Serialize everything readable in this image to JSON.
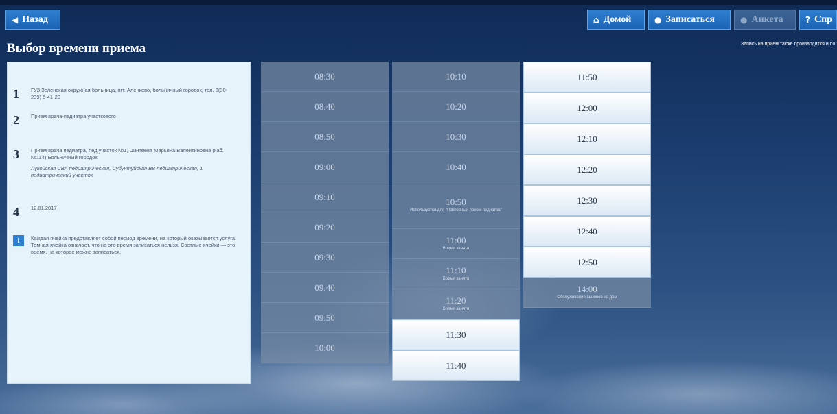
{
  "header": {
    "back_label": "Назад",
    "home_label": "Домой",
    "signup_label": "Записаться",
    "survey_label": "Анкета",
    "help_label": "Спр"
  },
  "page_title": "Выбор времени приема",
  "note_text": "Запись на прием также производится и по телефону",
  "steps": [
    {
      "num": "1",
      "text": "ГУЗ Зеленская окружная больница, пгт. Аленково, больничный городок, тел. 8(30-239) 5-41-20"
    },
    {
      "num": "2",
      "text": "Прием врача-педиатра участкового"
    },
    {
      "num": "3",
      "text": "Прием врача педиатра, пед.участок №1, Цинтеева Марьяна Валентиновна (каб.№114) Больничный городок",
      "sub": "Лукойская СВА педиатрическая, Субунтуйская ВВ педиатрическая, 1 педиатрический участок"
    },
    {
      "num": "4",
      "text": "12.01.2017"
    }
  ],
  "info_text": "Каждая ячейка представляет собой период времени, на который оказывается услуга. Темная ячейка означает, что на это время записаться нельзя. Светлые ячейки — это время, на которое можно записаться.",
  "columns": [
    [
      {
        "time": "08:30",
        "state": "busy"
      },
      {
        "time": "08:40",
        "state": "busy"
      },
      {
        "time": "08:50",
        "state": "busy"
      },
      {
        "time": "09:00",
        "state": "busy"
      },
      {
        "time": "09:10",
        "state": "busy"
      },
      {
        "time": "09:20",
        "state": "busy"
      },
      {
        "time": "09:30",
        "state": "busy"
      },
      {
        "time": "09:40",
        "state": "busy"
      },
      {
        "time": "09:50",
        "state": "busy"
      },
      {
        "time": "10:00",
        "state": "busy"
      }
    ],
    [
      {
        "time": "10:10",
        "state": "busy"
      },
      {
        "time": "10:20",
        "state": "busy"
      },
      {
        "time": "10:30",
        "state": "busy"
      },
      {
        "time": "10:40",
        "state": "busy"
      },
      {
        "time": "10:50",
        "state": "busy",
        "caption": "Используется для \"Повторный прием педиатра\""
      },
      {
        "time": "11:00",
        "state": "busy",
        "caption": "Время занято"
      },
      {
        "time": "11:10",
        "state": "busy",
        "caption": "Время занято"
      },
      {
        "time": "11:20",
        "state": "busy",
        "caption": "Время занято"
      },
      {
        "time": "11:30",
        "state": "free"
      },
      {
        "time": "11:40",
        "state": "free"
      }
    ],
    [
      {
        "time": "11:50",
        "state": "free"
      },
      {
        "time": "12:00",
        "state": "free"
      },
      {
        "time": "12:10",
        "state": "free"
      },
      {
        "time": "12:20",
        "state": "free"
      },
      {
        "time": "12:30",
        "state": "free"
      },
      {
        "time": "12:40",
        "state": "free"
      },
      {
        "time": "12:50",
        "state": "free"
      },
      {
        "time": "14:00",
        "state": "busy",
        "caption": "Обслуживание вызовов на дом"
      }
    ]
  ]
}
